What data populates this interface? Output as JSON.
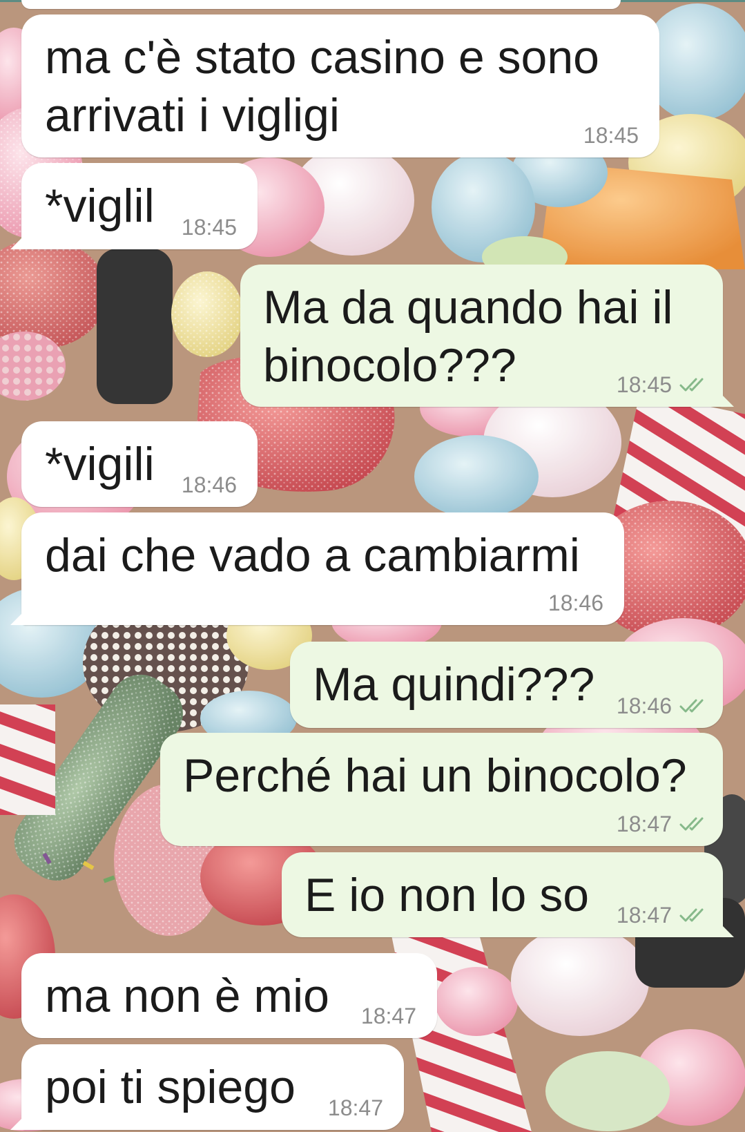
{
  "chat": {
    "messages": [
      {
        "outgoing": false,
        "text": "ma c'è stato casino e sono arrivati i vigligi",
        "time": "18:45"
      },
      {
        "outgoing": false,
        "text": "*viglil",
        "time": "18:45"
      },
      {
        "outgoing": true,
        "text": "Ma da quando hai il binocolo???",
        "time": "18:45",
        "status_icon": "double-check-icon"
      },
      {
        "outgoing": false,
        "text": "*vigili",
        "time": "18:46"
      },
      {
        "outgoing": false,
        "text": "dai che vado a cambiarmi",
        "time": "18:46"
      },
      {
        "outgoing": true,
        "text": "Ma quindi???",
        "time": "18:46",
        "status_icon": "double-check-icon"
      },
      {
        "outgoing": true,
        "text": "Perché hai un binocolo?",
        "time": "18:47",
        "status_icon": "double-check-icon"
      },
      {
        "outgoing": true,
        "text": "E io non lo so",
        "time": "18:47",
        "status_icon": "double-check-icon"
      },
      {
        "outgoing": false,
        "text": "ma non è mio",
        "time": "18:47"
      },
      {
        "outgoing": false,
        "text": "poi ti spiego",
        "time": "18:47"
      }
    ]
  },
  "colors": {
    "incoming_bubble": "#ffffff",
    "outgoing_bubble": "#edf8e3",
    "message_text": "#1b1b1b",
    "timestamp": "#8c8c8c",
    "ticks": "#86b98a"
  }
}
